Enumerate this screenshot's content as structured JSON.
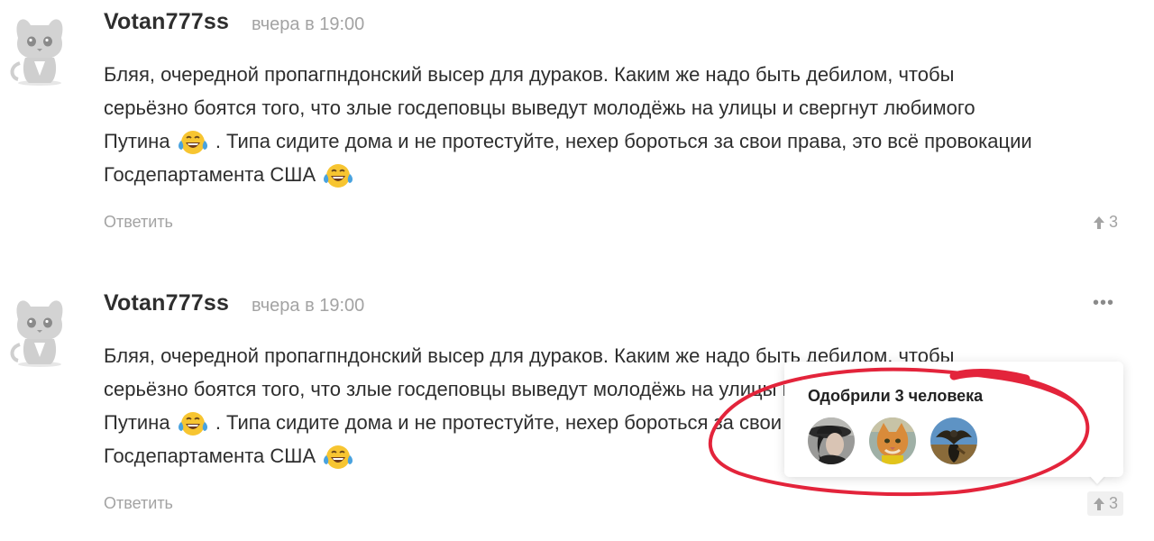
{
  "comments": [
    {
      "username": "Votan777ss",
      "timestamp": "вчера в 19:00",
      "line1": "Бляя, очередной пропагпндонский высер для дураков. Каким же надо быть дебилом, чтобы",
      "line2": "серьёзно боятся того, что злые госдеповцы выведут молодёжь на улицы и свергнут любимого",
      "line3a": "Путина",
      "line3b": ". Типа сидите дома и не протестуйте, нехер бороться за свои права, это всё провокации",
      "line4": "Госдепартамента США",
      "reply_label": "Ответить",
      "rating": "3"
    },
    {
      "username": "Votan777ss",
      "timestamp": "вчера в 19:00",
      "line1": "Бляя, очередной пропагпндонский высер для дураков. Каким же надо быть дебилом, чтобы",
      "line2": "серьёзно боятся того, что злые госдеповцы выведут молодёжь на улицы и свергнут любимого",
      "line3a": "Путина",
      "line3b": ". Типа сидите дома и не протестуйте, нехер бороться за свои права, это всё провокации",
      "line4": "Госдепартамента США",
      "reply_label": "Ответить",
      "rating": "3",
      "more_icon": "•••"
    }
  ],
  "popup": {
    "title": "Одобрили 3 человека",
    "avatars": [
      "user-avatar-woman-hat",
      "user-avatar-cat",
      "user-avatar-eagle"
    ]
  },
  "icons": {
    "emoji": "tears-of-joy-emoji",
    "rating": "arrow-up-icon",
    "more": "more-dots-icon"
  },
  "colors": {
    "text": "#2e2e2e",
    "muted": "#a3a3a3",
    "annotation": "#e3243b",
    "emoji_face": "#f7c531"
  }
}
